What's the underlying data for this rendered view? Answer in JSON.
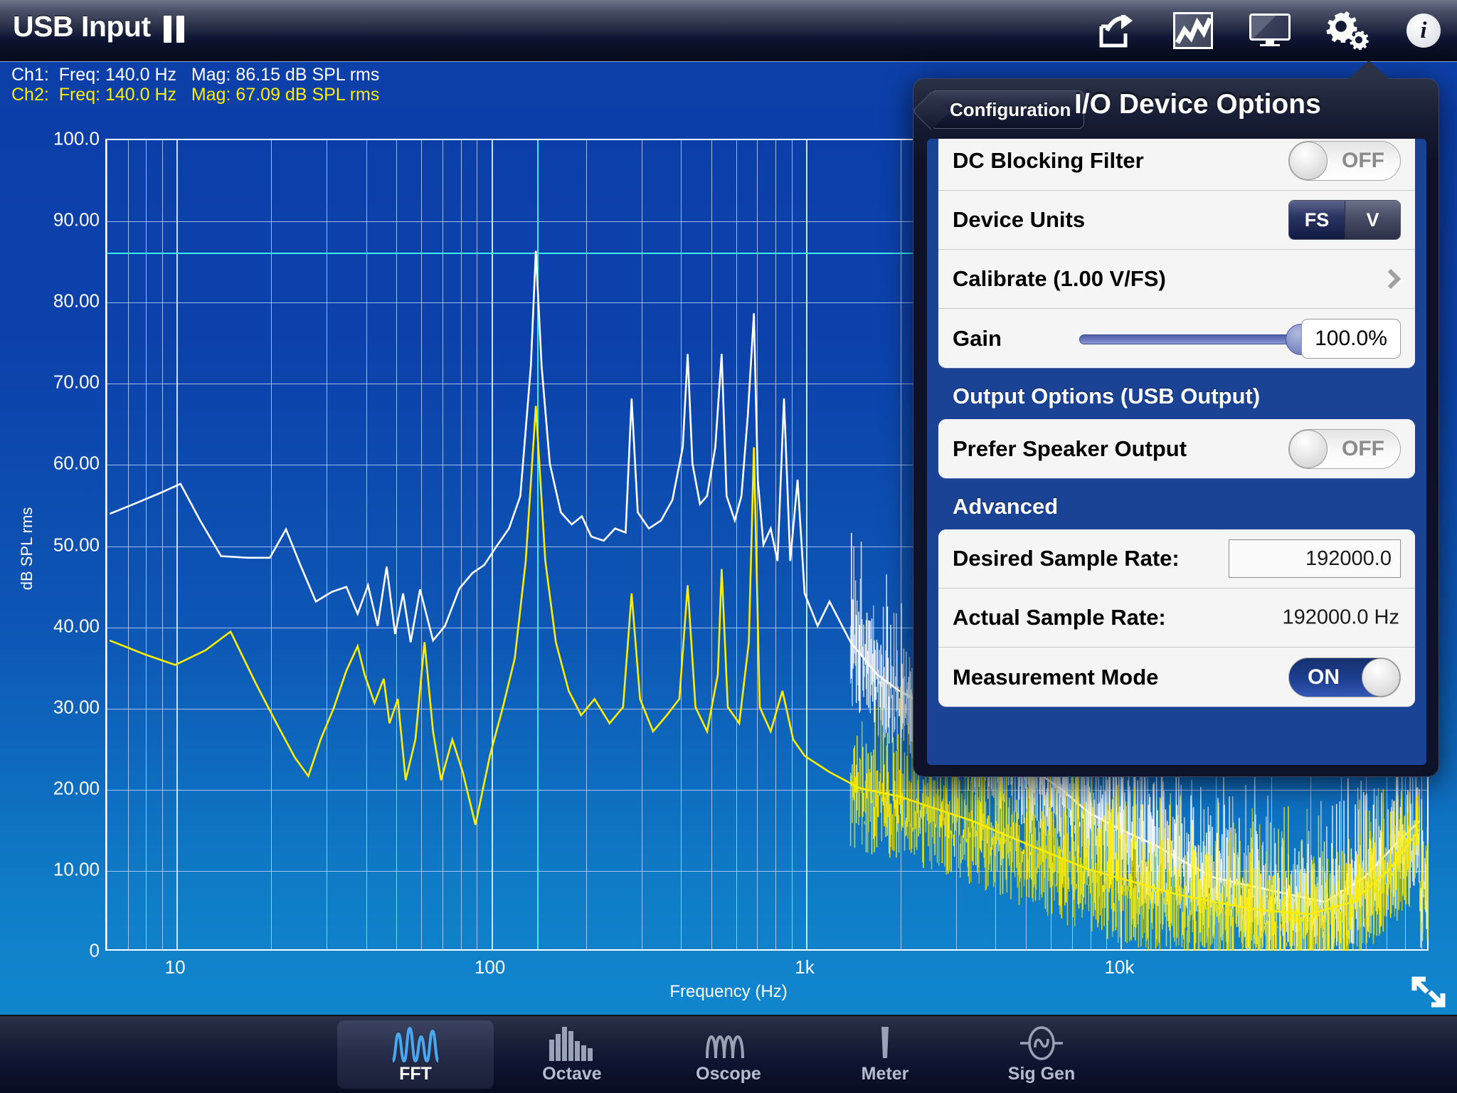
{
  "app": {
    "title": "USB Input",
    "pause_icon": "pause-icon"
  },
  "topbar": {
    "icons": [
      {
        "name": "share-icon",
        "label": "Share"
      },
      {
        "name": "chart-icon",
        "label": "Chart"
      },
      {
        "name": "display-icon",
        "label": "Display"
      },
      {
        "name": "gear-icon",
        "label": "Settings"
      },
      {
        "name": "info-icon",
        "label": "Info"
      }
    ]
  },
  "readouts": {
    "ch1": "Ch1:  Freq: 140.0 Hz   Mag: 86.15 dB SPL rms",
    "ch2": "Ch2:  Freq: 140.0 Hz   Mag: 67.09 dB SPL rms",
    "ch1_color": "#ffffff",
    "ch2_color": "#ffee00"
  },
  "popover": {
    "back_label": "Configuration",
    "title": "I/O Device Options",
    "rows": {
      "dc_blocking_filter": {
        "label": "DC Blocking Filter",
        "value": "OFF"
      },
      "device_units": {
        "label": "Device Units",
        "options": [
          "FS",
          "V"
        ],
        "selected": "FS"
      },
      "calibrate": {
        "label": "Calibrate (1.00 V/FS)"
      },
      "gain": {
        "label": "Gain",
        "value": "100.0%",
        "percent": 100
      }
    },
    "output_section": {
      "header": "Output Options (USB Output)",
      "prefer_speaker_output": {
        "label": "Prefer Speaker Output",
        "value": "OFF"
      }
    },
    "advanced_section": {
      "header": "Advanced",
      "desired_sample_rate": {
        "label": "Desired Sample Rate:",
        "value": "192000.0"
      },
      "actual_sample_rate": {
        "label": "Actual Sample Rate:",
        "value": "192000.0 Hz"
      },
      "measurement_mode": {
        "label": "Measurement Mode",
        "value": "ON"
      }
    }
  },
  "tabs": [
    {
      "label": "FFT",
      "icon": "fft-icon",
      "active": true
    },
    {
      "label": "Octave",
      "icon": "octave-icon",
      "active": false
    },
    {
      "label": "Oscope",
      "icon": "oscope-icon",
      "active": false
    },
    {
      "label": "Meter",
      "icon": "meter-icon",
      "active": false
    },
    {
      "label": "Sig Gen",
      "icon": "siggen-icon",
      "active": false
    }
  ],
  "chart_data": {
    "type": "line",
    "title": "",
    "xlabel": "Frequency (Hz)",
    "ylabel": "dB SPL rms",
    "xscale": "log",
    "xlim": [
      6,
      96000
    ],
    "ylim": [
      0,
      100
    ],
    "grid": true,
    "legend": "none",
    "ytick_labels": [
      "100.0",
      "90.00",
      "80.00",
      "70.00",
      "60.00",
      "50.00",
      "40.00",
      "30.00",
      "20.00",
      "10.00",
      "0"
    ],
    "ytick_values": [
      100,
      90,
      80,
      70,
      60,
      50,
      40,
      30,
      20,
      10,
      0
    ],
    "xtick_labels": [
      "10",
      "100",
      "1k",
      "10k"
    ],
    "xtick_values": [
      10,
      100,
      1000,
      10000
    ],
    "cursor": {
      "freq": 140.0,
      "ch1_mag": 86.15,
      "ch2_mag": 67.09,
      "color": "#3fe9f0"
    },
    "series": [
      {
        "name": "Ch1",
        "color": "#ffffff",
        "points": [
          [
            6.2,
            53.8
          ],
          [
            7.6,
            55.2
          ],
          [
            9.0,
            56.4
          ],
          [
            10.4,
            57.5
          ],
          [
            12.0,
            53.0
          ],
          [
            14.0,
            48.6
          ],
          [
            17.0,
            48.4
          ],
          [
            20.0,
            48.4
          ],
          [
            22.5,
            51.9
          ],
          [
            25.0,
            47.5
          ],
          [
            28.0,
            43.0
          ],
          [
            31.5,
            44.2
          ],
          [
            35.0,
            44.8
          ],
          [
            38.0,
            41.5
          ],
          [
            41.0,
            45.0
          ],
          [
            44.0,
            40.0
          ],
          [
            47.0,
            47.3
          ],
          [
            50.0,
            39.0
          ],
          [
            53.0,
            44.0
          ],
          [
            56.0,
            38.0
          ],
          [
            60.0,
            44.5
          ],
          [
            66.0,
            38.2
          ],
          [
            72.0,
            40.0
          ],
          [
            80.0,
            44.6
          ],
          [
            88.0,
            46.5
          ],
          [
            96.0,
            47.5
          ],
          [
            105.0,
            49.8
          ],
          [
            115.0,
            52.0
          ],
          [
            125.0,
            56.0
          ],
          [
            135.0,
            72.0
          ],
          [
            140.0,
            86.2
          ],
          [
            146.0,
            72.0
          ],
          [
            155.0,
            60.0
          ],
          [
            168.0,
            54.0
          ],
          [
            182.0,
            52.5
          ],
          [
            196.0,
            53.5
          ],
          [
            210.0,
            51.0
          ],
          [
            230.0,
            50.5
          ],
          [
            250.0,
            52.0
          ],
          [
            270.0,
            51.5
          ],
          [
            282.0,
            68.0
          ],
          [
            295.0,
            54.0
          ],
          [
            320.0,
            52.0
          ],
          [
            350.0,
            53.0
          ],
          [
            380.0,
            55.5
          ],
          [
            410.0,
            62.0
          ],
          [
            425.0,
            73.5
          ],
          [
            440.0,
            60.0
          ],
          [
            465.0,
            55.0
          ],
          [
            490.0,
            56.0
          ],
          [
            520.0,
            62.0
          ],
          [
            545.0,
            73.5
          ],
          [
            565.0,
            56.0
          ],
          [
            600.0,
            53.0
          ],
          [
            630.0,
            56.0
          ],
          [
            660.0,
            66.0
          ],
          [
            690.0,
            78.5
          ],
          [
            710.0,
            58.0
          ],
          [
            740.0,
            50.0
          ],
          [
            780.0,
            52.0
          ],
          [
            820.0,
            48.0
          ],
          [
            860.0,
            68.0
          ],
          [
            900.0,
            48.0
          ],
          [
            950.0,
            58.0
          ],
          [
            1000.0,
            44.0
          ],
          [
            1100.0,
            40.0
          ],
          [
            1200.0,
            43.0
          ],
          [
            1400.0,
            38.0
          ],
          [
            1700.0,
            34.0
          ],
          [
            2000.0,
            32.0
          ],
          [
            2500.0,
            30.0
          ],
          [
            3000.0,
            28.0
          ],
          [
            4000.0,
            26.0
          ],
          [
            5000.0,
            23.0
          ],
          [
            6500.0,
            20.0
          ],
          [
            8000.0,
            17.0
          ],
          [
            10000.0,
            15.0
          ],
          [
            13000.0,
            13.0
          ],
          [
            16000.0,
            11.0
          ],
          [
            20000.0,
            9.0
          ],
          [
            26000.0,
            8.0
          ],
          [
            34000.0,
            7.0
          ],
          [
            45000.0,
            6.0
          ],
          [
            60000.0,
            9.0
          ],
          [
            75000.0,
            13.0
          ],
          [
            90000.0,
            16.0
          ]
        ]
      },
      {
        "name": "Ch2",
        "color": "#ffee00",
        "points": [
          [
            6.2,
            38.2
          ],
          [
            8.0,
            36.5
          ],
          [
            10.0,
            35.2
          ],
          [
            12.5,
            37.0
          ],
          [
            15.0,
            39.3
          ],
          [
            18.0,
            33.0
          ],
          [
            21.0,
            28.0
          ],
          [
            24.0,
            23.8
          ],
          [
            26.5,
            21.5
          ],
          [
            29.0,
            26.0
          ],
          [
            32.0,
            30.0
          ],
          [
            35.0,
            34.5
          ],
          [
            38.0,
            37.5
          ],
          [
            40.0,
            34.0
          ],
          [
            43.0,
            30.5
          ],
          [
            46.0,
            33.5
          ],
          [
            48.0,
            28.0
          ],
          [
            51.0,
            31.0
          ],
          [
            54.0,
            21.0
          ],
          [
            58.0,
            26.0
          ],
          [
            62.0,
            38.0
          ],
          [
            66.0,
            27.0
          ],
          [
            70.0,
            21.0
          ],
          [
            76.0,
            26.0
          ],
          [
            82.0,
            22.0
          ],
          [
            90.0,
            15.5
          ],
          [
            100.0,
            24.0
          ],
          [
            110.0,
            30.0
          ],
          [
            120.0,
            36.0
          ],
          [
            130.0,
            48.0
          ],
          [
            140.0,
            67.1
          ],
          [
            150.0,
            48.0
          ],
          [
            162.0,
            38.0
          ],
          [
            178.0,
            32.0
          ],
          [
            195.0,
            29.0
          ],
          [
            215.0,
            31.0
          ],
          [
            240.0,
            28.0
          ],
          [
            265.0,
            30.0
          ],
          [
            282.0,
            44.0
          ],
          [
            300.0,
            31.0
          ],
          [
            330.0,
            27.0
          ],
          [
            365.0,
            29.0
          ],
          [
            400.0,
            31.0
          ],
          [
            425.0,
            45.0
          ],
          [
            450.0,
            30.0
          ],
          [
            490.0,
            27.0
          ],
          [
            530.0,
            34.0
          ],
          [
            545.0,
            47.0
          ],
          [
            570.0,
            30.0
          ],
          [
            620.0,
            28.0
          ],
          [
            665.0,
            38.0
          ],
          [
            690.0,
            62.0
          ],
          [
            720.0,
            30.0
          ],
          [
            780.0,
            27.0
          ],
          [
            850.0,
            32.0
          ],
          [
            920.0,
            26.0
          ],
          [
            1000.0,
            24.0
          ],
          [
            1200.0,
            22.0
          ],
          [
            1500.0,
            20.0
          ],
          [
            2000.0,
            19.0
          ],
          [
            2600.0,
            17.5
          ],
          [
            3400.0,
            16.0
          ],
          [
            4500.0,
            14.0
          ],
          [
            6000.0,
            12.0
          ],
          [
            8000.0,
            10.0
          ],
          [
            11000.0,
            8.5
          ],
          [
            15000.0,
            7.0
          ],
          [
            20000.0,
            6.0
          ],
          [
            28000.0,
            5.0
          ],
          [
            40000.0,
            4.5
          ],
          [
            55000.0,
            6.0
          ],
          [
            72000.0,
            10.0
          ],
          [
            90000.0,
            15.0
          ]
        ]
      }
    ]
  }
}
